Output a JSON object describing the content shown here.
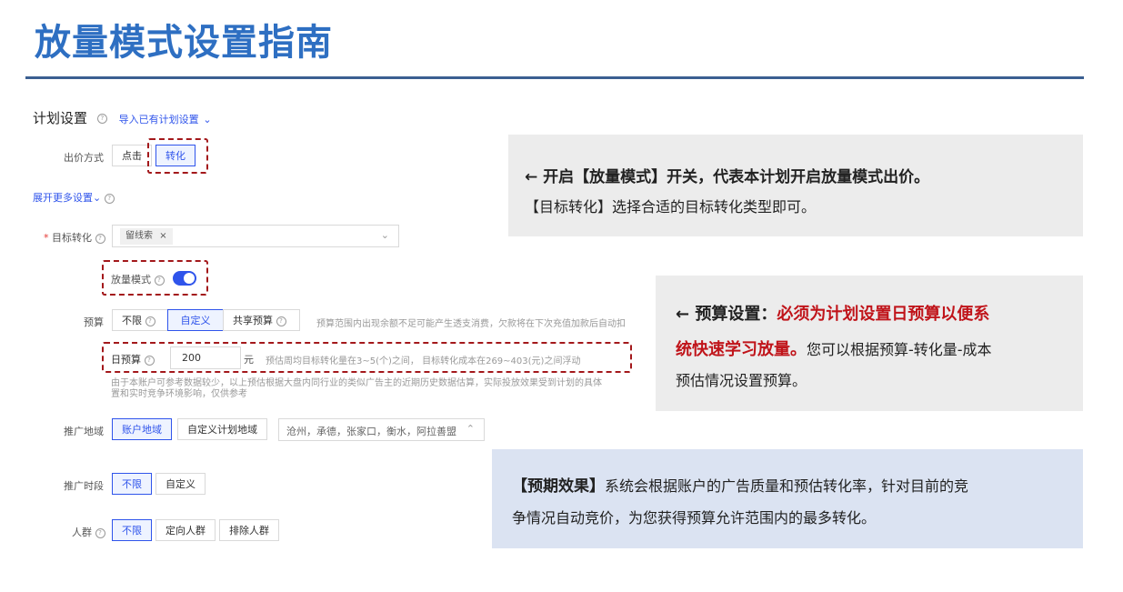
{
  "title": "放量模式设置指南",
  "plan": {
    "section_title": "计划设置",
    "import_link": "导入已有计划设置",
    "bid_label": "出价方式",
    "bid_options": [
      "点击",
      "转化"
    ],
    "expand_link": "展开更多设置",
    "target_label": "目标转化",
    "target_tag": "留线索",
    "boost_label": "放量模式",
    "boost_on": true,
    "budget_label": "预算",
    "budget_options": [
      "不限",
      "自定义",
      "共享预算"
    ],
    "budget_note": "预算范围内出现余额不足可能产生透支消费，欠款将在下次充值加款后自动扣",
    "daily_label": "日预算",
    "daily_value": "200",
    "daily_unit": "元",
    "daily_estimate": "预估周均目标转化量在3~5(个)之间，  目标转化成本在269~403(元)之间浮动",
    "disclaimer_1": "由于本账户可参考数据较少，以上预估根据大盘内同行业的类似广告主的近期历史数据估算，实际投放效果受到计划的具体",
    "disclaimer_2": "置和实时竞争环境影响，仅供参考",
    "region_label": "推广地域",
    "region_options": [
      "账户地域",
      "自定义计划地域"
    ],
    "region_value": "沧州，承德，张家口，衡水，阿拉善盟",
    "time_label": "推广时段",
    "time_options": [
      "不限",
      "自定义"
    ],
    "audience_label": "人群",
    "audience_options": [
      "不限",
      "定向人群",
      "排除人群"
    ]
  },
  "callouts": {
    "c1_line1": "← 开启【放量模式】开关，代表本计划开启放量模式出价。",
    "c1_line2": "【目标转化】选择合适的目标转化类型即可。",
    "c2_prefix": "← 预算设置：",
    "c2_red1": "必须为计划设置日预算以便系",
    "c2_red2": "统快速学习放量。",
    "c2_rest2": "您可以根据预算-转化量-成本",
    "c2_line3": "预估情况设置预算。",
    "c3_head": "【预期效果】",
    "c3_line1": "系统会根据账户的广告质量和预估转化率，针对目前的竞",
    "c3_line2": "争情况自动竞价，为您获得预算允许范围内的最多转化。"
  },
  "colors": {
    "title": "#2e6fc2",
    "accent": "#2f54eb",
    "dash": "#a3181b",
    "emphasis": "#c0141a"
  }
}
